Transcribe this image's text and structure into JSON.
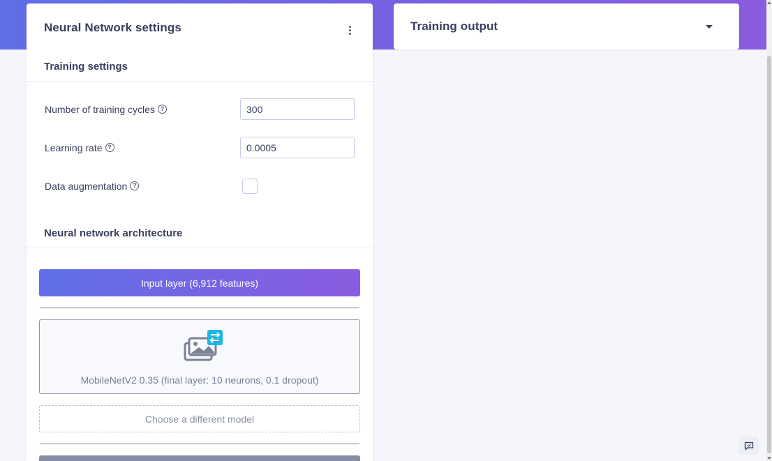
{
  "left_panel": {
    "title": "Neural Network settings",
    "menu_icon": "kebab-menu-icon",
    "training_settings": {
      "title": "Training settings",
      "fields": [
        {
          "label": "Number of training cycles",
          "value": "300"
        },
        {
          "label": "Learning rate",
          "value": "0.0005"
        },
        {
          "label": "Data augmentation",
          "checked": false
        }
      ]
    },
    "architecture": {
      "title": "Neural network architecture",
      "input_layer": "Input layer (6,912 features)",
      "model": "MobileNetV2 0.35 (final layer: 10 neurons, 0.1 dropout)",
      "model_icon": "image-transfer-icon",
      "choose_model": "Choose a different model"
    }
  },
  "right_panel": {
    "title": "Training output",
    "toggle_icon": "caret-down-icon"
  },
  "colors": {
    "gradient_start": "#5f6fe6",
    "gradient_end": "#8b5ce0",
    "accent_cyan": "#1fb6e0"
  }
}
